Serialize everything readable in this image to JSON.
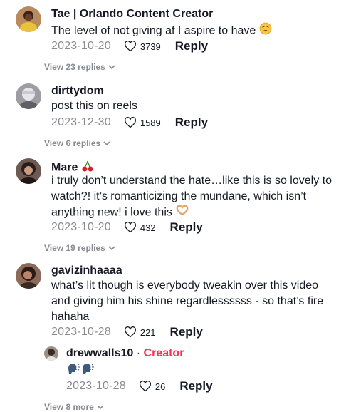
{
  "comments": [
    {
      "username": "Tae | Orlando Content Creator",
      "text": "The level of not giving af I aspire to have",
      "emoji": "tired-face",
      "date": "2023-10-20",
      "likes": "3739",
      "reply_label": "Reply",
      "view_replies": "View 23 replies"
    },
    {
      "username": "dirttydom",
      "text": "post this on reels",
      "date": "2023-12-30",
      "likes": "1589",
      "reply_label": "Reply",
      "view_replies": "View 6 replies"
    },
    {
      "username": "Mare",
      "username_emoji": "cherries",
      "text_line1": "i truly don’t understand the hate…like this is so lovely to",
      "text_line2": "watch?! it’s romanticizing the mundane, which isn’t",
      "text_line3": "anything new! i love this",
      "emoji": "heart-hands",
      "date": "2023-10-20",
      "likes": "432",
      "reply_label": "Reply",
      "view_replies": "View 19 replies"
    },
    {
      "username": "gavizinhaaaa",
      "text_line1": "what’s lit though is everybody tweakin over this video",
      "text_line2": "and giving him his shine regardlessssss - so that’s fire",
      "text_line3": "hahaha",
      "date": "2023-10-28",
      "likes": "221",
      "reply_label": "Reply"
    }
  ],
  "reply": {
    "username": "drewwalls10",
    "separator": "·",
    "badge": "Creator",
    "emoji": "speaking-head-x2",
    "date": "2023-10-28",
    "likes": "26",
    "reply_label": "Reply",
    "view_replies": "View 8 more"
  },
  "colors": {
    "creator_badge": "#fe2c55",
    "muted": "#8a8b91",
    "text": "#161823"
  }
}
